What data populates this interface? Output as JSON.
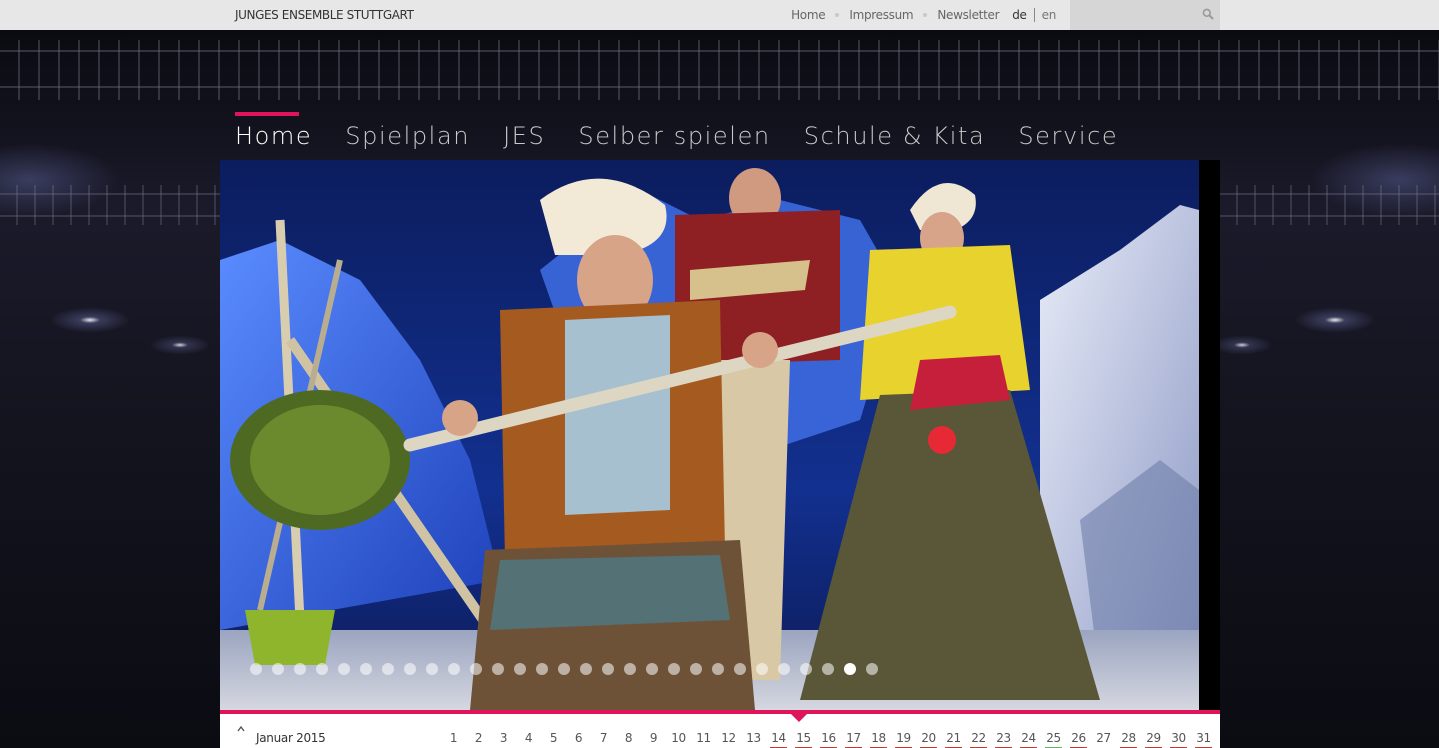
{
  "site": {
    "brand": "JUNGES ENSEMBLE STUTTGART"
  },
  "meta_nav": {
    "items": [
      "Home",
      "Impressum",
      "Newsletter"
    ],
    "lang_current": "de",
    "lang_other": "en"
  },
  "search": {
    "placeholder": ""
  },
  "main_nav": {
    "items": [
      "Home",
      "Spielplan",
      "JES",
      "Selber spielen",
      "Schule & Kita",
      "Service"
    ],
    "active_index": 0
  },
  "slider": {
    "total_dots": 29,
    "active_dot": 27
  },
  "calendar": {
    "month": "Januar 2015",
    "days": [
      "1",
      "2",
      "3",
      "4",
      "5",
      "6",
      "7",
      "8",
      "9",
      "10",
      "11",
      "12",
      "13",
      "14",
      "15",
      "16",
      "17",
      "18",
      "19",
      "20",
      "21",
      "22",
      "23",
      "24",
      "25",
      "26",
      "27",
      "28",
      "29",
      "30",
      "31"
    ],
    "event_days": [
      "14",
      "15",
      "16",
      "17",
      "18",
      "19",
      "20",
      "21",
      "22",
      "23",
      "24",
      "26",
      "28",
      "29",
      "30",
      "31"
    ],
    "today_day": "25",
    "selected_day": "15"
  },
  "colors": {
    "accent": "#e0145a",
    "event_underline": "#c0392b",
    "today_underline": "#5cb85c"
  }
}
